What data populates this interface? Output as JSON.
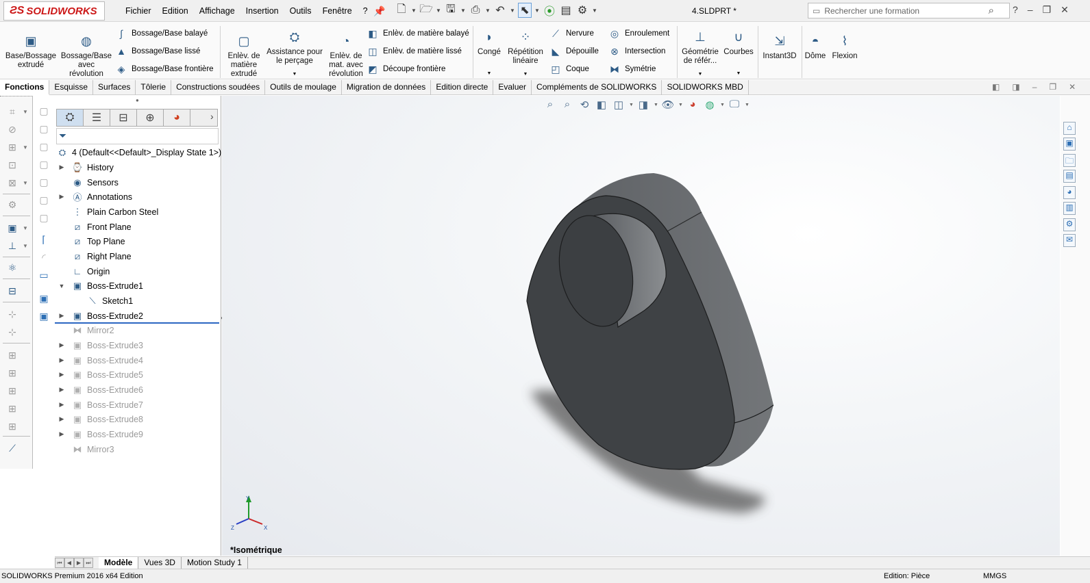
{
  "app": {
    "logo_text": "SOLIDWORKS",
    "document_title": "4.SLDPRT *",
    "accent": "#cc1717"
  },
  "menu": [
    "Fichier",
    "Edition",
    "Affichage",
    "Insertion",
    "Outils",
    "Fenêtre",
    "?"
  ],
  "search": {
    "placeholder": "Rechercher une formation"
  },
  "ribbon": {
    "extrude": "Base/Bossage extrudé",
    "revolve": "Bossage/Base avec révolution",
    "sweep": "Bossage/Base balayé",
    "loft": "Bossage/Base lissé",
    "boundary": "Bossage/Base frontière",
    "cut_extrude": "Enlèv. de matière extrudé",
    "hole_wizard": "Assistance pour le perçage",
    "cut_revolve": "Enlèv. de mat. avec révolution",
    "cut_sweep": "Enlèv. de matière balayé",
    "cut_loft": "Enlèv. de matière lissé",
    "cut_boundary": "Découpe frontière",
    "fillet": "Congé",
    "linear_pattern": "Répétition linéaire",
    "rib": "Nervure",
    "draft": "Dépouille",
    "shell": "Coque",
    "wrap": "Enroulement",
    "intersect": "Intersection",
    "mirror": "Symétrie",
    "ref_geometry": "Géométrie de référ...",
    "curves": "Courbes",
    "instant3d": "Instant3D",
    "dome": "Dôme",
    "flex": "Flexion"
  },
  "tabs": [
    "Fonctions",
    "Esquisse",
    "Surfaces",
    "Tôlerie",
    "Constructions soudées",
    "Outils de moulage",
    "Migration de données",
    "Edition directe",
    "Evaluer",
    "Compléments de SOLIDWORKS",
    "SOLIDWORKS MBD"
  ],
  "tree": {
    "root": "4  (Default<<Default>_Display State 1>)",
    "items": [
      {
        "label": "History",
        "icon": "history-icon"
      },
      {
        "label": "Sensors",
        "icon": "sensor-icon"
      },
      {
        "label": "Annotations",
        "icon": "annotations-icon"
      },
      {
        "label": "Plain Carbon Steel",
        "icon": "material-icon"
      },
      {
        "label": "Front Plane",
        "icon": "plane-icon"
      },
      {
        "label": "Top Plane",
        "icon": "plane-icon"
      },
      {
        "label": "Right Plane",
        "icon": "plane-icon"
      },
      {
        "label": "Origin",
        "icon": "origin-icon"
      },
      {
        "label": "Boss-Extrude1",
        "icon": "extrude-icon"
      },
      {
        "label": "Sketch1",
        "icon": "sketch-icon"
      },
      {
        "label": "Boss-Extrude2",
        "icon": "extrude-icon"
      },
      {
        "label": "Mirror2",
        "icon": "mirror-icon"
      },
      {
        "label": "Boss-Extrude3",
        "icon": "extrude-icon"
      },
      {
        "label": "Boss-Extrude4",
        "icon": "extrude-icon"
      },
      {
        "label": "Boss-Extrude5",
        "icon": "extrude-icon"
      },
      {
        "label": "Boss-Extrude6",
        "icon": "extrude-icon"
      },
      {
        "label": "Boss-Extrude7",
        "icon": "extrude-icon"
      },
      {
        "label": "Boss-Extrude8",
        "icon": "extrude-icon"
      },
      {
        "label": "Boss-Extrude9",
        "icon": "extrude-icon"
      },
      {
        "label": "Mirror3",
        "icon": "mirror-icon"
      }
    ]
  },
  "viewport": {
    "view_label": "*Isométrique"
  },
  "bottom_tabs": [
    "Modèle",
    "Vues 3D",
    "Motion Study 1"
  ],
  "status": {
    "left": "SOLIDWORKS Premium 2016 x64 Edition",
    "mode": "Edition: Pièce",
    "units": "MMGS"
  }
}
